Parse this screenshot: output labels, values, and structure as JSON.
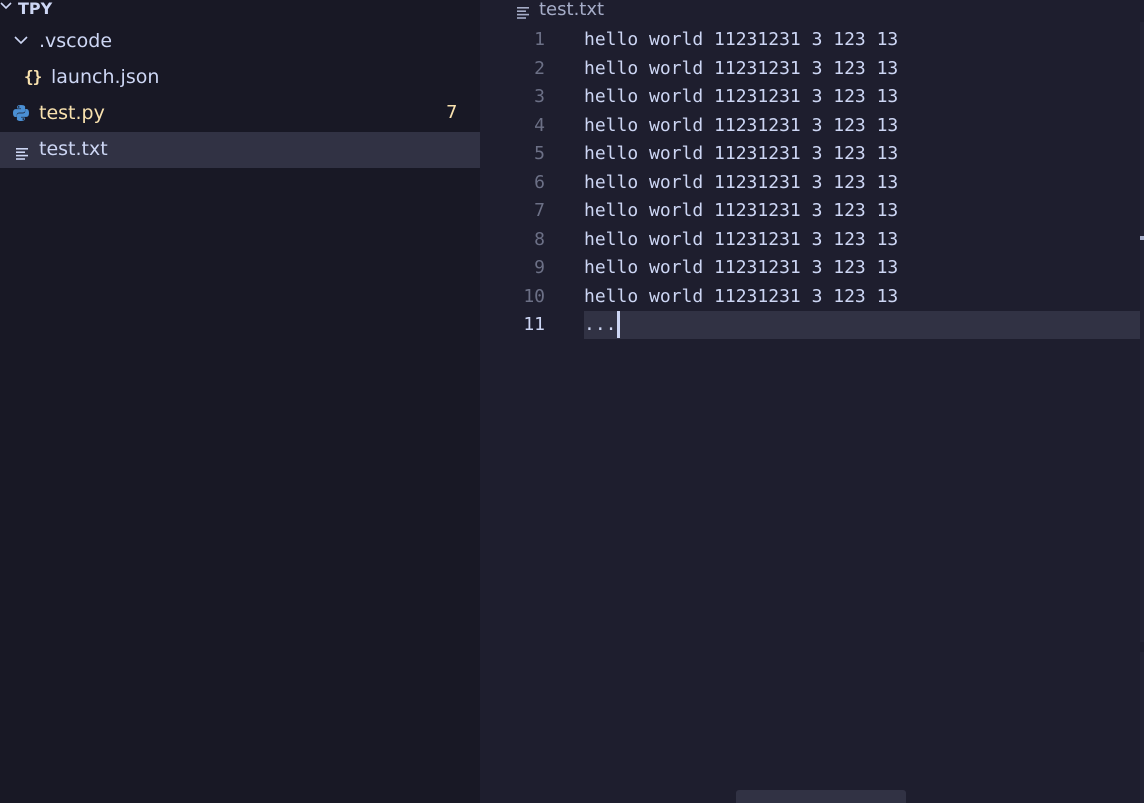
{
  "explorer": {
    "root": {
      "label": "TPY",
      "icon": "chevron-down-icon"
    },
    "items": [
      {
        "label": ".vscode",
        "icon": "chevron-down-icon",
        "type": "folder"
      },
      {
        "label": "launch.json",
        "icon_glyph": "{}",
        "icon": "json-braces-icon",
        "type": "file"
      },
      {
        "label": "test.py",
        "icon": "python-icon",
        "type": "file",
        "badge": "7"
      },
      {
        "label": "test.txt",
        "icon": "text-file-icon",
        "type": "file",
        "selected": true
      }
    ]
  },
  "editor": {
    "breadcrumb": {
      "file": "test.txt",
      "icon": "text-file-icon"
    },
    "line_numbers": [
      "1",
      "2",
      "3",
      "4",
      "5",
      "6",
      "7",
      "8",
      "9",
      "10",
      "11"
    ],
    "lines": [
      "hello world 11231231 3 123 13",
      "hello world 11231231 3 123 13",
      "hello world 11231231 3 123 13",
      "hello world 11231231 3 123 13",
      "hello world 11231231 3 123 13",
      "hello world 11231231 3 123 13",
      "hello world 11231231 3 123 13",
      "hello world 11231231 3 123 13",
      "hello world 11231231 3 123 13",
      "hello world 11231231 3 123 13",
      "..."
    ],
    "current_line": 11
  },
  "colors": {
    "sidebar_bg": "#181825",
    "editor_bg": "#1e1e2e",
    "selection_bg": "#313244",
    "text": "#cdd6f4",
    "warning_yellow": "#f9e2af",
    "muted": "#6c7086"
  }
}
